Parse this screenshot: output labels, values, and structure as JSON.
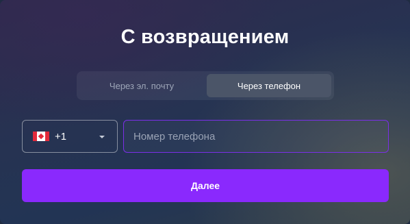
{
  "title": "С возвращением",
  "tabs": [
    {
      "label": "Через эл. почту",
      "active": false
    },
    {
      "label": "Через телефон",
      "active": true
    }
  ],
  "country": {
    "flag_icon": "canada-flag-icon",
    "code": "+1"
  },
  "phone": {
    "placeholder": "Номер телефона",
    "value": ""
  },
  "submit_label": "Далее",
  "colors": {
    "accent": "#8a29fd",
    "focus_border": "#7b2fe8",
    "active_tab": "#4b5568",
    "flag_red": "#e2293b"
  }
}
